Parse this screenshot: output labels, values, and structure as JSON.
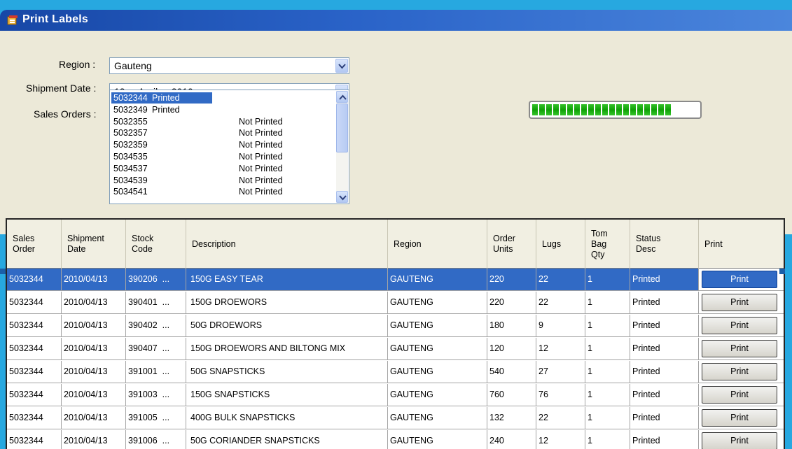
{
  "window": {
    "title": "Print Labels"
  },
  "form": {
    "region_label": "Region :",
    "region_value": "Gauteng",
    "shipment_date_label": "Shipment Date :",
    "shipment_date_value": "13     April     2010",
    "sales_orders_label": "Sales Orders :"
  },
  "sales_orders": [
    {
      "number": "5032344",
      "status": "Printed",
      "selected": true
    },
    {
      "number": "5032349",
      "status": "Printed"
    },
    {
      "number": "5032355",
      "status": "Not Printed"
    },
    {
      "number": "5032357",
      "status": "Not Printed"
    },
    {
      "number": "5032359",
      "status": "Not Printed"
    },
    {
      "number": "5034535",
      "status": "Not Printed"
    },
    {
      "number": "5034537",
      "status": "Not Printed"
    },
    {
      "number": "5034539",
      "status": "Not Printed"
    },
    {
      "number": "5034541",
      "status": "Not Printed"
    }
  ],
  "progress": {
    "fraction": 1.0,
    "segments": 20
  },
  "grid": {
    "columns": [
      "Sales\nOrder",
      "Shipment\nDate",
      "Stock\nCode",
      "Description",
      "Region",
      "Order\nUnits",
      "Lugs",
      "Tom\nBag\nQty",
      "Status\nDesc",
      "Print"
    ],
    "rows": [
      {
        "sales_order": "5032344",
        "shipment_date": "2010/04/13",
        "stock_code": "390206  ...",
        "description": "150G EASY TEAR",
        "region": "GAUTENG",
        "order_units": "220",
        "lugs": "22",
        "tom_bag_qty": "1",
        "status": "Printed",
        "print_label": "Print",
        "selected": true
      },
      {
        "sales_order": "5032344",
        "shipment_date": "2010/04/13",
        "stock_code": "390401  ...",
        "description": "150G DROEWORS",
        "region": "GAUTENG",
        "order_units": "220",
        "lugs": "22",
        "tom_bag_qty": "1",
        "status": "Printed",
        "print_label": "Print"
      },
      {
        "sales_order": "5032344",
        "shipment_date": "2010/04/13",
        "stock_code": "390402  ...",
        "description": "50G DROEWORS",
        "region": "GAUTENG",
        "order_units": "180",
        "lugs": "9",
        "tom_bag_qty": "1",
        "status": "Printed",
        "print_label": "Print"
      },
      {
        "sales_order": "5032344",
        "shipment_date": "2010/04/13",
        "stock_code": "390407  ...",
        "description": "150G DROEWORS AND BILTONG MIX",
        "region": "GAUTENG",
        "order_units": "120",
        "lugs": "12",
        "tom_bag_qty": "1",
        "status": "Printed",
        "print_label": "Print"
      },
      {
        "sales_order": "5032344",
        "shipment_date": "2010/04/13",
        "stock_code": "391001  ...",
        "description": "50G SNAPSTICKS",
        "region": "GAUTENG",
        "order_units": "540",
        "lugs": "27",
        "tom_bag_qty": "1",
        "status": "Printed",
        "print_label": "Print"
      },
      {
        "sales_order": "5032344",
        "shipment_date": "2010/04/13",
        "stock_code": "391003  ...",
        "description": "150G SNAPSTICKS",
        "region": "GAUTENG",
        "order_units": "760",
        "lugs": "76",
        "tom_bag_qty": "1",
        "status": "Printed",
        "print_label": "Print"
      },
      {
        "sales_order": "5032344",
        "shipment_date": "2010/04/13",
        "stock_code": "391005  ...",
        "description": "400G BULK SNAPSTICKS",
        "region": "GAUTENG",
        "order_units": "132",
        "lugs": "22",
        "tom_bag_qty": "1",
        "status": "Printed",
        "print_label": "Print"
      },
      {
        "sales_order": "5032344",
        "shipment_date": "2010/04/13",
        "stock_code": "391006  ...",
        "description": "50G CORIANDER SNAPSTICKS",
        "region": "GAUTENG",
        "order_units": "240",
        "lugs": "12",
        "tom_bag_qty": "1",
        "status": "Printed",
        "print_label": "Print"
      }
    ]
  },
  "colors": {
    "frame": "#27a8e0",
    "titlebar": "#2a63c8",
    "selection": "#316ac5",
    "progress_fill": "#0fa106",
    "form_background": "#ece9d8"
  },
  "icons": {
    "window": "app-window-icon",
    "dropdown": "chevron-down-icon",
    "scroll_up": "arrow-up-icon",
    "scroll_down": "arrow-down-icon"
  }
}
